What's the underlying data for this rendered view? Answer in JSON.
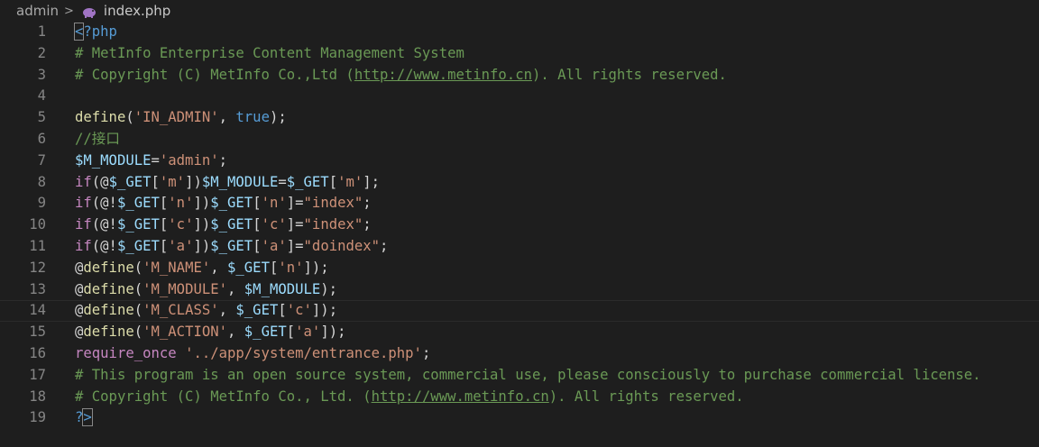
{
  "breadcrumb": {
    "folder": "admin",
    "separator": ">",
    "file": "index.php"
  },
  "lines": [
    {
      "n": "1",
      "tokens": [
        {
          "t": "<",
          "c": "c-tag bracket-box"
        },
        {
          "t": "?php",
          "c": "c-tag"
        }
      ]
    },
    {
      "n": "2",
      "tokens": [
        {
          "t": "# MetInfo Enterprise Content Management System",
          "c": "c-comment"
        }
      ]
    },
    {
      "n": "3",
      "tokens": [
        {
          "t": "# Copyright (C) MetInfo Co.,Ltd (",
          "c": "c-comment"
        },
        {
          "t": "http://www.metinfo.cn",
          "c": "c-comment c-link"
        },
        {
          "t": "). All rights reserved.",
          "c": "c-comment"
        }
      ]
    },
    {
      "n": "4",
      "tokens": []
    },
    {
      "n": "5",
      "tokens": [
        {
          "t": "define",
          "c": "c-func"
        },
        {
          "t": "(",
          "c": "c-punc"
        },
        {
          "t": "'IN_ADMIN'",
          "c": "c-str"
        },
        {
          "t": ", ",
          "c": "c-punc"
        },
        {
          "t": "true",
          "c": "c-bool"
        },
        {
          "t": ");",
          "c": "c-punc"
        }
      ]
    },
    {
      "n": "6",
      "tokens": [
        {
          "t": "//接口",
          "c": "c-comment"
        }
      ]
    },
    {
      "n": "7",
      "tokens": [
        {
          "t": "$M_MODULE",
          "c": "c-var"
        },
        {
          "t": "=",
          "c": "c-punc"
        },
        {
          "t": "'admin'",
          "c": "c-str"
        },
        {
          "t": ";",
          "c": "c-punc"
        }
      ]
    },
    {
      "n": "8",
      "tokens": [
        {
          "t": "if",
          "c": "c-kw"
        },
        {
          "t": "(@",
          "c": "c-punc"
        },
        {
          "t": "$_GET",
          "c": "c-var"
        },
        {
          "t": "[",
          "c": "c-punc"
        },
        {
          "t": "'m'",
          "c": "c-str"
        },
        {
          "t": "])",
          "c": "c-punc"
        },
        {
          "t": "$M_MODULE",
          "c": "c-var"
        },
        {
          "t": "=",
          "c": "c-punc"
        },
        {
          "t": "$_GET",
          "c": "c-var"
        },
        {
          "t": "[",
          "c": "c-punc"
        },
        {
          "t": "'m'",
          "c": "c-str"
        },
        {
          "t": "];",
          "c": "c-punc"
        }
      ]
    },
    {
      "n": "9",
      "tokens": [
        {
          "t": "if",
          "c": "c-kw"
        },
        {
          "t": "(@!",
          "c": "c-punc"
        },
        {
          "t": "$_GET",
          "c": "c-var"
        },
        {
          "t": "[",
          "c": "c-punc"
        },
        {
          "t": "'n'",
          "c": "c-str"
        },
        {
          "t": "])",
          "c": "c-punc"
        },
        {
          "t": "$_GET",
          "c": "c-var"
        },
        {
          "t": "[",
          "c": "c-punc"
        },
        {
          "t": "'n'",
          "c": "c-str"
        },
        {
          "t": "]=",
          "c": "c-punc"
        },
        {
          "t": "\"index\"",
          "c": "c-str"
        },
        {
          "t": ";",
          "c": "c-punc"
        }
      ]
    },
    {
      "n": "10",
      "tokens": [
        {
          "t": "if",
          "c": "c-kw"
        },
        {
          "t": "(@!",
          "c": "c-punc"
        },
        {
          "t": "$_GET",
          "c": "c-var"
        },
        {
          "t": "[",
          "c": "c-punc"
        },
        {
          "t": "'c'",
          "c": "c-str"
        },
        {
          "t": "])",
          "c": "c-punc"
        },
        {
          "t": "$_GET",
          "c": "c-var"
        },
        {
          "t": "[",
          "c": "c-punc"
        },
        {
          "t": "'c'",
          "c": "c-str"
        },
        {
          "t": "]=",
          "c": "c-punc"
        },
        {
          "t": "\"index\"",
          "c": "c-str"
        },
        {
          "t": ";",
          "c": "c-punc"
        }
      ]
    },
    {
      "n": "11",
      "tokens": [
        {
          "t": "if",
          "c": "c-kw"
        },
        {
          "t": "(@!",
          "c": "c-punc"
        },
        {
          "t": "$_GET",
          "c": "c-var"
        },
        {
          "t": "[",
          "c": "c-punc"
        },
        {
          "t": "'a'",
          "c": "c-str"
        },
        {
          "t": "])",
          "c": "c-punc"
        },
        {
          "t": "$_GET",
          "c": "c-var"
        },
        {
          "t": "[",
          "c": "c-punc"
        },
        {
          "t": "'a'",
          "c": "c-str"
        },
        {
          "t": "]=",
          "c": "c-punc"
        },
        {
          "t": "\"doindex\"",
          "c": "c-str"
        },
        {
          "t": ";",
          "c": "c-punc"
        }
      ]
    },
    {
      "n": "12",
      "tokens": [
        {
          "t": "@",
          "c": "c-punc"
        },
        {
          "t": "define",
          "c": "c-func"
        },
        {
          "t": "(",
          "c": "c-punc"
        },
        {
          "t": "'M_NAME'",
          "c": "c-str"
        },
        {
          "t": ", ",
          "c": "c-punc"
        },
        {
          "t": "$_GET",
          "c": "c-var"
        },
        {
          "t": "[",
          "c": "c-punc"
        },
        {
          "t": "'n'",
          "c": "c-str"
        },
        {
          "t": "]);",
          "c": "c-punc"
        }
      ]
    },
    {
      "n": "13",
      "tokens": [
        {
          "t": "@",
          "c": "c-punc"
        },
        {
          "t": "define",
          "c": "c-func"
        },
        {
          "t": "(",
          "c": "c-punc"
        },
        {
          "t": "'M_MODULE'",
          "c": "c-str"
        },
        {
          "t": ", ",
          "c": "c-punc"
        },
        {
          "t": "$M_MODULE",
          "c": "c-var"
        },
        {
          "t": ");",
          "c": "c-punc"
        }
      ]
    },
    {
      "n": "14",
      "current": true,
      "tokens": [
        {
          "t": "@",
          "c": "c-punc"
        },
        {
          "t": "define",
          "c": "c-func"
        },
        {
          "t": "(",
          "c": "c-punc"
        },
        {
          "t": "'M_CLASS'",
          "c": "c-str"
        },
        {
          "t": ", ",
          "c": "c-punc"
        },
        {
          "t": "$_GET",
          "c": "c-var"
        },
        {
          "t": "[",
          "c": "c-punc"
        },
        {
          "t": "'c'",
          "c": "c-str"
        },
        {
          "t": "]);",
          "c": "c-punc"
        }
      ]
    },
    {
      "n": "15",
      "tokens": [
        {
          "t": "@",
          "c": "c-punc"
        },
        {
          "t": "define",
          "c": "c-func"
        },
        {
          "t": "(",
          "c": "c-punc"
        },
        {
          "t": "'M_ACTION'",
          "c": "c-str"
        },
        {
          "t": ", ",
          "c": "c-punc"
        },
        {
          "t": "$_GET",
          "c": "c-var"
        },
        {
          "t": "[",
          "c": "c-punc"
        },
        {
          "t": "'a'",
          "c": "c-str"
        },
        {
          "t": "]);",
          "c": "c-punc"
        }
      ]
    },
    {
      "n": "16",
      "tokens": [
        {
          "t": "require_once",
          "c": "c-kw"
        },
        {
          "t": " ",
          "c": "c-punc"
        },
        {
          "t": "'../app/system/entrance.php'",
          "c": "c-str"
        },
        {
          "t": ";",
          "c": "c-punc"
        }
      ]
    },
    {
      "n": "17",
      "tokens": [
        {
          "t": "# This program is an open source system, commercial use, please consciously to purchase commercial license.",
          "c": "c-comment"
        }
      ]
    },
    {
      "n": "18",
      "tokens": [
        {
          "t": "# Copyright (C) MetInfo Co., Ltd. (",
          "c": "c-comment"
        },
        {
          "t": "http://www.metinfo.cn",
          "c": "c-comment c-link"
        },
        {
          "t": "). All rights reserved.",
          "c": "c-comment"
        }
      ]
    },
    {
      "n": "19",
      "tokens": [
        {
          "t": "?",
          "c": "c-tag"
        },
        {
          "t": ">",
          "c": "c-tag bracket-box"
        }
      ]
    }
  ]
}
